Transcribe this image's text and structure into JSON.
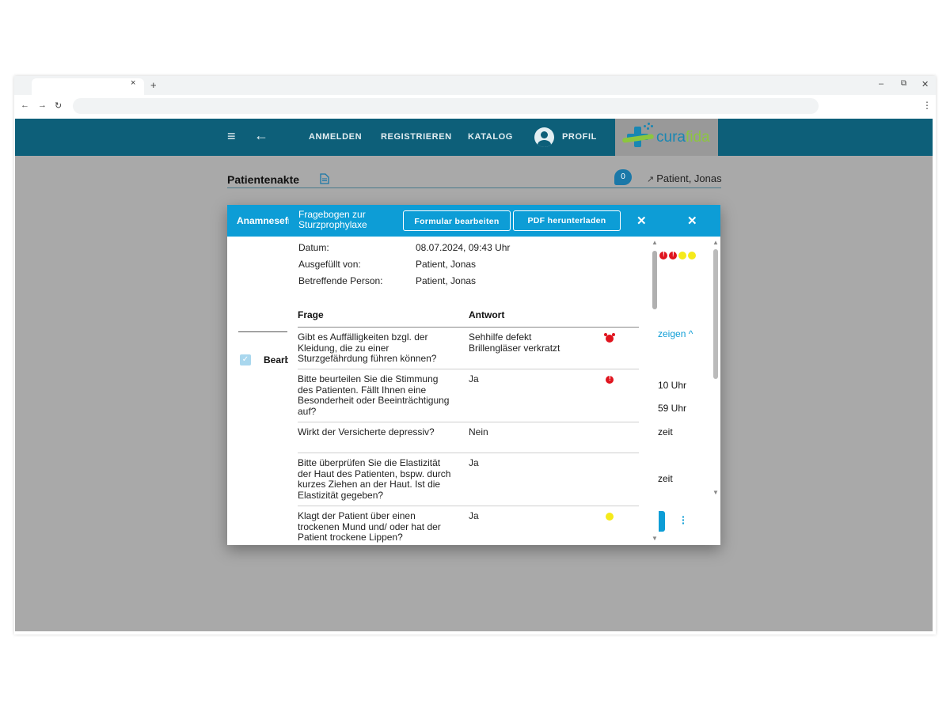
{
  "browser": {
    "tab_close": "×",
    "new_tab": "+",
    "minimize": "–",
    "restore": "⧉",
    "close": "✕",
    "back": "←",
    "forward": "→",
    "reload": "↻",
    "menu": "⋮"
  },
  "appbar": {
    "menu_icon": "≡",
    "back_icon": "←",
    "nav": [
      "ANMELDEN",
      "REGISTRIEREN",
      "KATALOG"
    ],
    "profile_label": "PROFIL",
    "logo_cura": "cura",
    "logo_fida": "fida",
    "colors": {
      "bar": "#0d5f79",
      "logo_blue": "#1987b3",
      "logo_green": "#8cc63f"
    }
  },
  "page": {
    "title": "Patientenakte",
    "chat_count": "0",
    "patient_name": "Patient, Jonas"
  },
  "background_panel": {
    "tab_label": "Anamnesefragebogen",
    "bearb_label": "Bearbeitet",
    "show_link": "zeigen ^",
    "time1": "10 Uhr",
    "time2": "59 Uhr",
    "text3": "zeit",
    "text4": "zeit",
    "status_dots": [
      "red",
      "red",
      "yellow",
      "yellow"
    ]
  },
  "modal": {
    "title": "Fragebogen zur Sturzprophylaxe",
    "edit_button": "Formular bearbeiten",
    "pdf_button": "PDF herunterladen",
    "close_icon": "✕",
    "accent": "#0d9dd6",
    "meta": [
      {
        "label": "Datum:",
        "value": "08.07.2024, 09:43 Uhr"
      },
      {
        "label": "Ausgefüllt von:",
        "value": "Patient, Jonas"
      },
      {
        "label": "Betreffende Person:",
        "value": "Patient, Jonas"
      }
    ],
    "table": {
      "headers": {
        "question": "Frage",
        "answer": "Antwort"
      },
      "rows": [
        {
          "question": "Gibt es Auffälligkeiten bzgl. der Kleidung, die zu einer Sturzgefährdung führen können?",
          "answer": "Sehhilfe defekt\nBrillengläser verkratzt",
          "indicator": "alarm-icon"
        },
        {
          "question": "Bitte beurteilen Sie die Stimmung des Patienten. Fällt Ihnen eine Besonderheit oder Beeinträchtigung auf?",
          "answer": "Ja",
          "indicator": "red-alert-icon"
        },
        {
          "question": "Wirkt der Versicherte depressiv?",
          "answer": "Nein",
          "indicator": ""
        },
        {
          "question": "Bitte überprüfen Sie die Elastizität der Haut des Patienten, bspw. durch kurzes Ziehen an der Haut. Ist die Elastizität gegeben?",
          "answer": "Ja",
          "indicator": ""
        },
        {
          "question": "Klagt der Patient über einen trockenen Mund und/ oder hat der Patient trockene Lippen?",
          "answer": "Ja",
          "indicator": "yellow-dot-icon"
        }
      ]
    }
  }
}
